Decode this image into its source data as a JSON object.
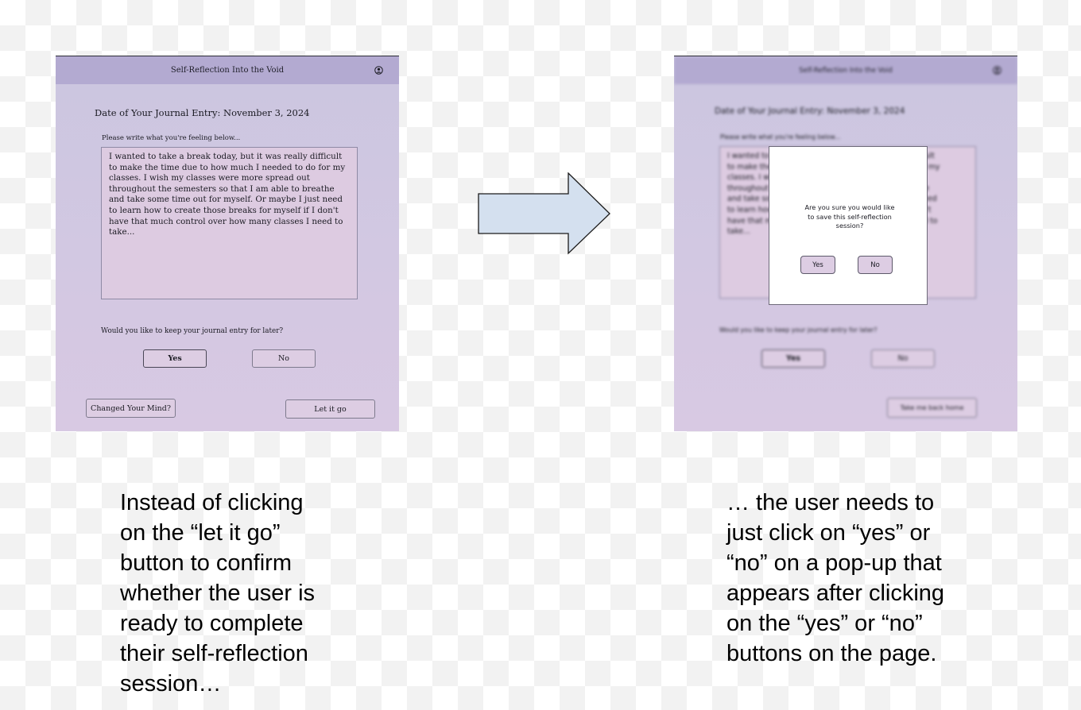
{
  "accent_colors": {
    "header_bg": "#b3aad1",
    "panel_bg": "#cbc6e0",
    "button_bg": "#ddcde3",
    "arrow_fill": "#d4e0ef"
  },
  "before": {
    "header_title": "Self-Reflection Into the Void",
    "profile_icon": "profile-icon",
    "date_label": "Date of Your Journal Entry: November 3, 2024",
    "prompt": "Please write what you're feeling below...",
    "journal_lines": [
      "I wanted to  take a break today, but it was really difficult",
      "to make the time due to how much I needed to do for my",
      "classes. I wish my classes were more spread out",
      "throughout the semesters so that I am able to breathe",
      "and take some time out for myself. Or maybe I just need",
      "to learn how to create those breaks for myself if I don't",
      "have that much control over how many classes I need to",
      "take..."
    ],
    "keep_question": "Would you like to keep your journal entry for later?",
    "yes_label": "Yes",
    "no_label": "No",
    "changed_mind_label": "Changed Your Mind?",
    "let_go_label": "Let it go"
  },
  "after": {
    "header_title": "Self-Reflection Into the Void",
    "profile_icon": "profile-icon",
    "date_label": "Date of Your Journal Entry: November 3, 2024",
    "prompt": "Please write what you're feeling below...",
    "journal_lines": [
      "I wanted to  take a break today, but it was really difficult",
      "to make the time due to how much I needed to do for my",
      "classes. I wish my classes were more spread out",
      "throughout the semesters so that I am able to breathe",
      "and take some time out for myself. Or maybe I just need",
      "to learn how to create those breaks for myself if I don't",
      "have that much control over how many classes I need to",
      "take..."
    ],
    "keep_question": "Would you like to keep your journal entry for later?",
    "yes_label": "Yes",
    "no_label": "No",
    "home_label": "Take me back home",
    "dialog": {
      "lines": [
        "Are you sure you would like",
        "to save this self-reflection",
        "session?"
      ],
      "yes_label": "Yes",
      "no_label": "No"
    }
  },
  "arrow_icon": "right-arrow-icon",
  "captions": {
    "left": [
      "Instead of clicking",
      "on the “let it go”",
      "button to confirm",
      "whether the user is",
      "ready to complete",
      "their self-reflection",
      "session…"
    ],
    "right": [
      "… the user needs to",
      "just click on “yes” or",
      "“no” on a pop-up that",
      "appears after clicking",
      "on the “yes” or “no”",
      "buttons on the page."
    ]
  }
}
